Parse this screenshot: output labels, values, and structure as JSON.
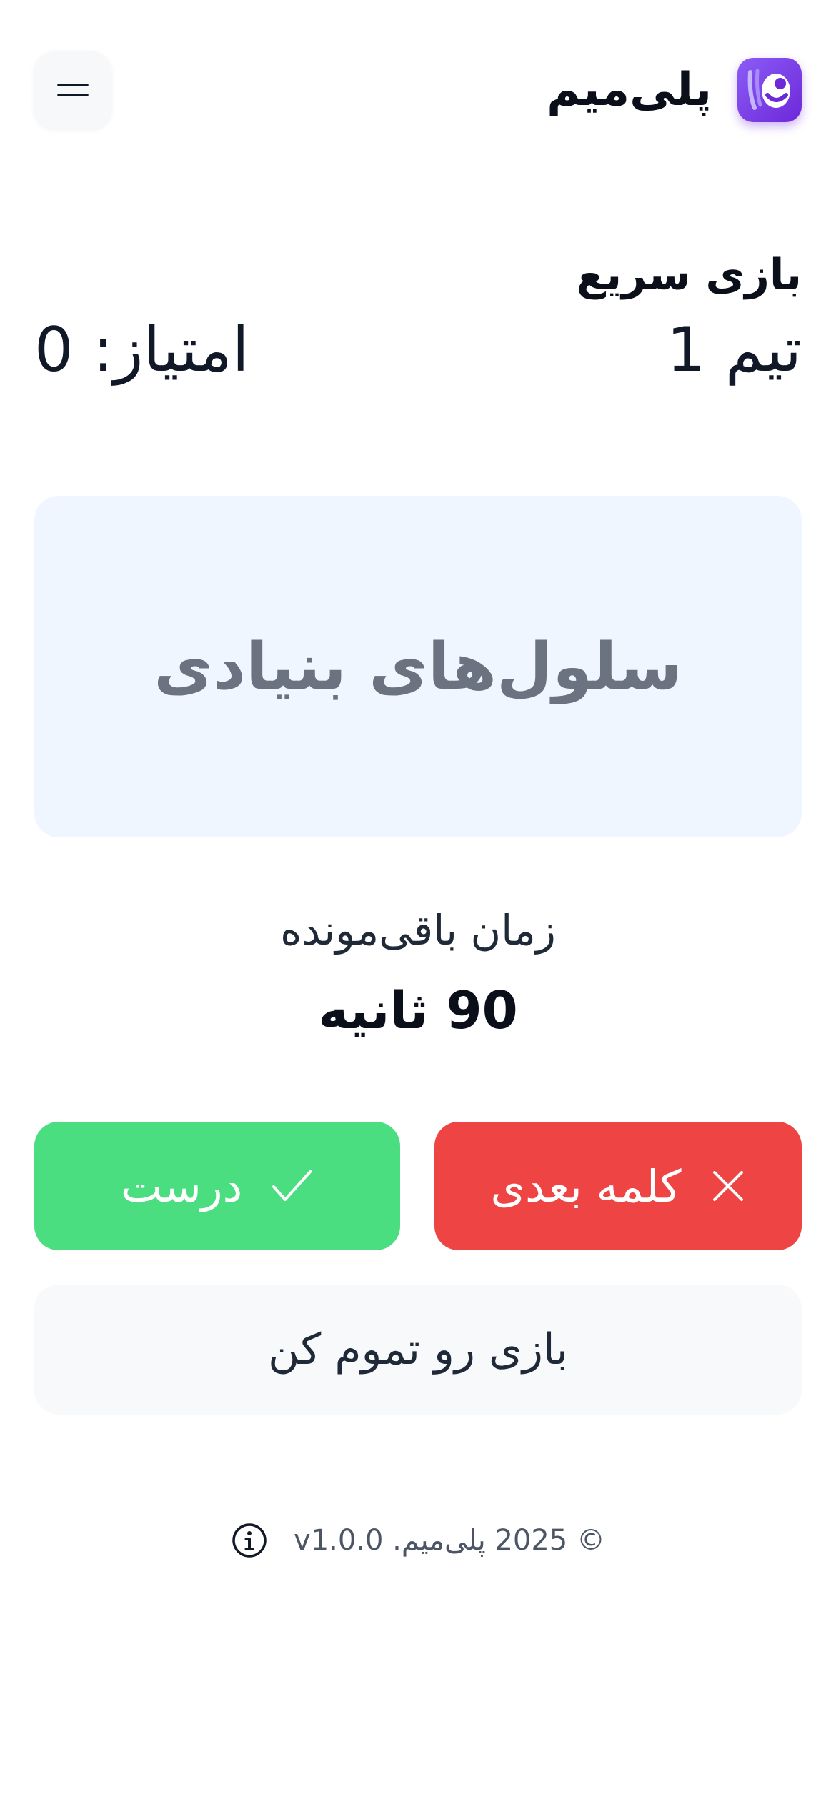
{
  "header": {
    "app_name": "پلی‌میم",
    "menu_icon": "hamburger-icon",
    "logo_icon": "app-logo-icon",
    "logo_color": "#7c3aed"
  },
  "game": {
    "mode_title": "بازی سریع",
    "team_name": "تیم 1",
    "score_text": "امتیاز: 0"
  },
  "word_card": {
    "word": "سلول‌های بنیادی",
    "background": "#eff6ff"
  },
  "timer": {
    "label": "زمان باقی‌مونده",
    "value": "90 ثانیه"
  },
  "actions": {
    "correct_label": "درست",
    "correct_icon": "check-icon",
    "correct_color": "#4ade80",
    "next_label": "کلمه بعدی",
    "next_icon": "close-icon",
    "next_color": "#ef4444",
    "end_label": "بازی رو تموم کن"
  },
  "footer": {
    "text": "© 2025 پلی‌میم. v1.0.0",
    "info_icon": "info-icon"
  }
}
